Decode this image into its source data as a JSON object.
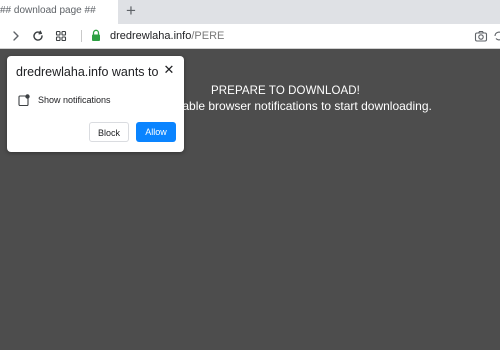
{
  "browser": {
    "tab_title": "## download page ##",
    "new_tab_symbol": "+",
    "address": {
      "host": "dredrewlaha.info",
      "path": "/PERE"
    },
    "icons": [
      "forward-icon",
      "reload-icon",
      "grid-icon",
      "lock-icon",
      "camera-icon",
      "sync-icon"
    ]
  },
  "page": {
    "headline": "PREPARE TO DOWNLOAD!",
    "subline": "enable browser notifications to start downloading."
  },
  "notification_prompt": {
    "title": "dredrewlaha.info wants to",
    "close_symbol": "✕",
    "permission": "Show notifications",
    "block_label": "Block",
    "allow_label": "Allow"
  },
  "colors": {
    "page_background": "#4d4d4d",
    "allow_button": "#0a84ff",
    "lock_green": "#2ea043"
  }
}
